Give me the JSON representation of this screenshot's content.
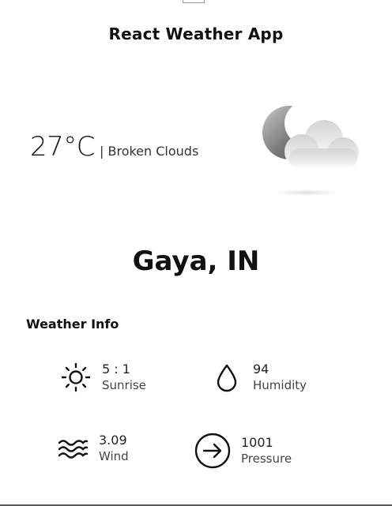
{
  "app": {
    "title": "React Weather App"
  },
  "current": {
    "temperature": "27°C",
    "description": "| Broken Clouds",
    "icon": "moon-clouds-icon"
  },
  "location": {
    "city": "Gaya, IN"
  },
  "info": {
    "heading": "Weather Info",
    "items": [
      {
        "icon": "sun-icon",
        "value": "5 : 1",
        "label": "Sunrise"
      },
      {
        "icon": "droplet-icon",
        "value": "94",
        "label": "Humidity"
      },
      {
        "icon": "wind-icon",
        "value": "3.09",
        "label": "Wind"
      },
      {
        "icon": "pressure-icon",
        "value": "1001",
        "label": "Pressure"
      }
    ]
  }
}
